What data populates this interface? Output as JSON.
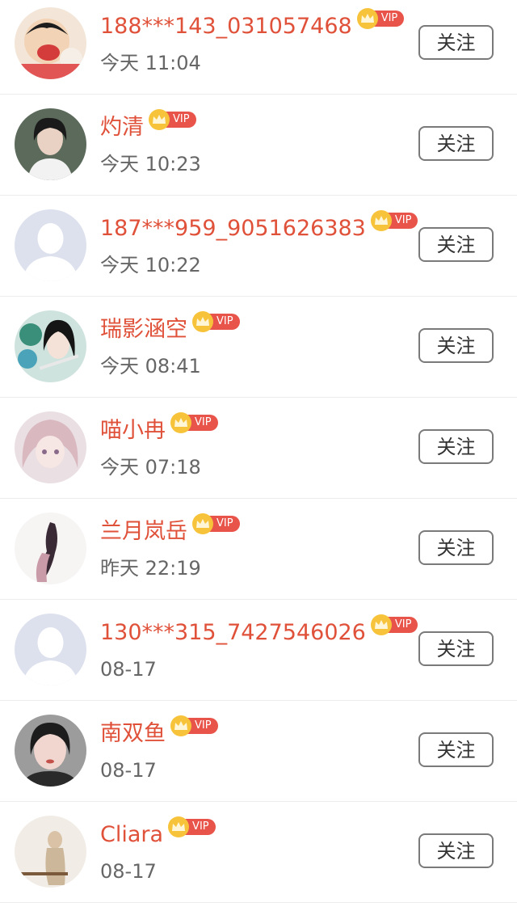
{
  "vip_label": "VIP",
  "follow_label": "关注",
  "colors": {
    "name": "#e0513a",
    "vip_tag": "#e8534a",
    "crown": "#f6c33b",
    "time": "#666666"
  },
  "users": [
    {
      "name": "188***143_031057468",
      "time": "今天 11:04",
      "avatar": "cartoon-avatar"
    },
    {
      "name": "灼清",
      "time": "今天 10:23",
      "avatar": "photo-avatar"
    },
    {
      "name": "187***959_9051626383",
      "time": "今天 10:22",
      "avatar": "default-avatar"
    },
    {
      "name": "瑞影涵空",
      "time": "今天 08:41",
      "avatar": "illustration-avatar"
    },
    {
      "name": "喵小冉",
      "time": "今天 07:18",
      "avatar": "illustration-avatar"
    },
    {
      "name": "兰月岚岳",
      "time": "昨天 22:19",
      "avatar": "illustration-avatar"
    },
    {
      "name": "130***315_7427546026",
      "time": "08-17",
      "avatar": "default-avatar"
    },
    {
      "name": "南双鱼",
      "time": "08-17",
      "avatar": "photo-avatar"
    },
    {
      "name": "Cliara",
      "time": "08-17",
      "avatar": "photo-avatar"
    }
  ]
}
